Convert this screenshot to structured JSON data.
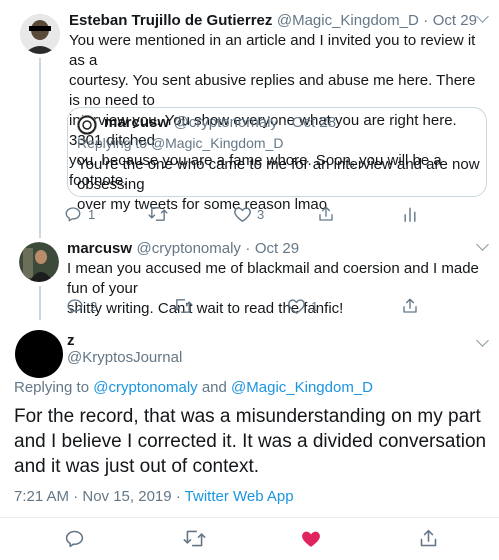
{
  "tweet1": {
    "name": "Esteban Trujillo de Gutierrez",
    "handle": "@Magic_Kingdom_D",
    "sep": "·",
    "date": "Oct 29",
    "text_lines": [
      "You were mentioned in an article and I invited you to review it as a",
      "courtesy. You sent abusive replies and abuse me here. There is no need to",
      "interview you. You show everyone what you are right here. 3301 ditched",
      "you, because you are a fame whore. Soon, you will be a footnote."
    ],
    "quote": {
      "name": "marcusw",
      "handle": "@cryptonomaly",
      "sep": "·",
      "date": "Oct 28",
      "replying_prefix": "Replying to ",
      "replying_to": "@Magic_Kingdom_D",
      "text_lines": [
        "You're the one who came to me for an interview and are now obsessing",
        "over my tweets for some reason lmao"
      ]
    },
    "replies": "1",
    "likes": "3"
  },
  "tweet2": {
    "name": "marcusw",
    "handle": "@cryptonomaly",
    "sep": "·",
    "date": "Oct 29",
    "text_lines": [
      "I mean you accused me of blackmail and coersion and I made fun of your",
      "shitty writing. Can't wait to read the fanfic!"
    ],
    "replies": "2",
    "likes": "1"
  },
  "main_tweet": {
    "name": "z",
    "handle": "@KryptosJournal",
    "replying_prefix": "Replying to ",
    "mention1": "@cryptonomaly",
    "and": " and ",
    "mention2": "@Magic_Kingdom_D",
    "text_lines": [
      "For the record, that was a misunderstanding on my part",
      "and I believe I corrected it. It was a divided conversation",
      "and it was just out of context."
    ],
    "timestamp": "7:21 AM · Nov 15, 2019 · ",
    "source": "Twitter Web App"
  },
  "colors": {
    "accent": "#1b95e0",
    "like_active": "#e0245e",
    "secondary_text": "#657786",
    "divider": "#e6ecf0"
  }
}
